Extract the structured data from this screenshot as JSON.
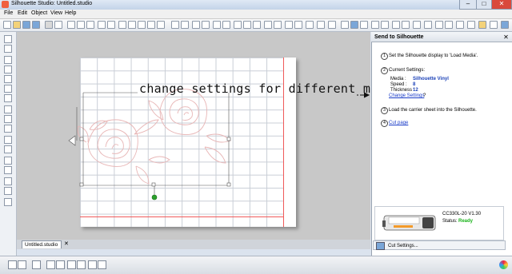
{
  "window": {
    "title": "Silhouette Studio: Untitled.studio",
    "min": "–",
    "max": "□",
    "close": "✕"
  },
  "menu": [
    "File",
    "Edit",
    "Object",
    "View",
    "Help"
  ],
  "doc_tab": {
    "label": "Untitled.studio",
    "close": "✕"
  },
  "panel": {
    "title": "Send to Silhouette",
    "close": "✕",
    "step1": {
      "num": "1",
      "text": "Set the Silhouette display to 'Load Media'."
    },
    "step2": {
      "num": "2",
      "text": "Current Settings:"
    },
    "media_label": "Media :",
    "media_value": "Silhouette Vinyl",
    "speed_label": "Speed :",
    "speed_value": "8",
    "thickness_label": "Thickness :",
    "thickness_value": "12",
    "change_link": "Change Settings",
    "change_q": "?",
    "step3": {
      "num": "3",
      "text": "Load the carrier sheet into the Silhouette."
    },
    "step4": {
      "num": "4",
      "text": "Cut page"
    },
    "device_name": "CC330L-20 V1.30",
    "status_label": "Status:",
    "status_value": "Ready",
    "cut_settings": "Cut Settings..."
  },
  "annotation": "change settings for different medias",
  "colors": {
    "status_ready": "#19b319",
    "cut_line": "#f05a5a",
    "link": "#1a3cc8"
  }
}
